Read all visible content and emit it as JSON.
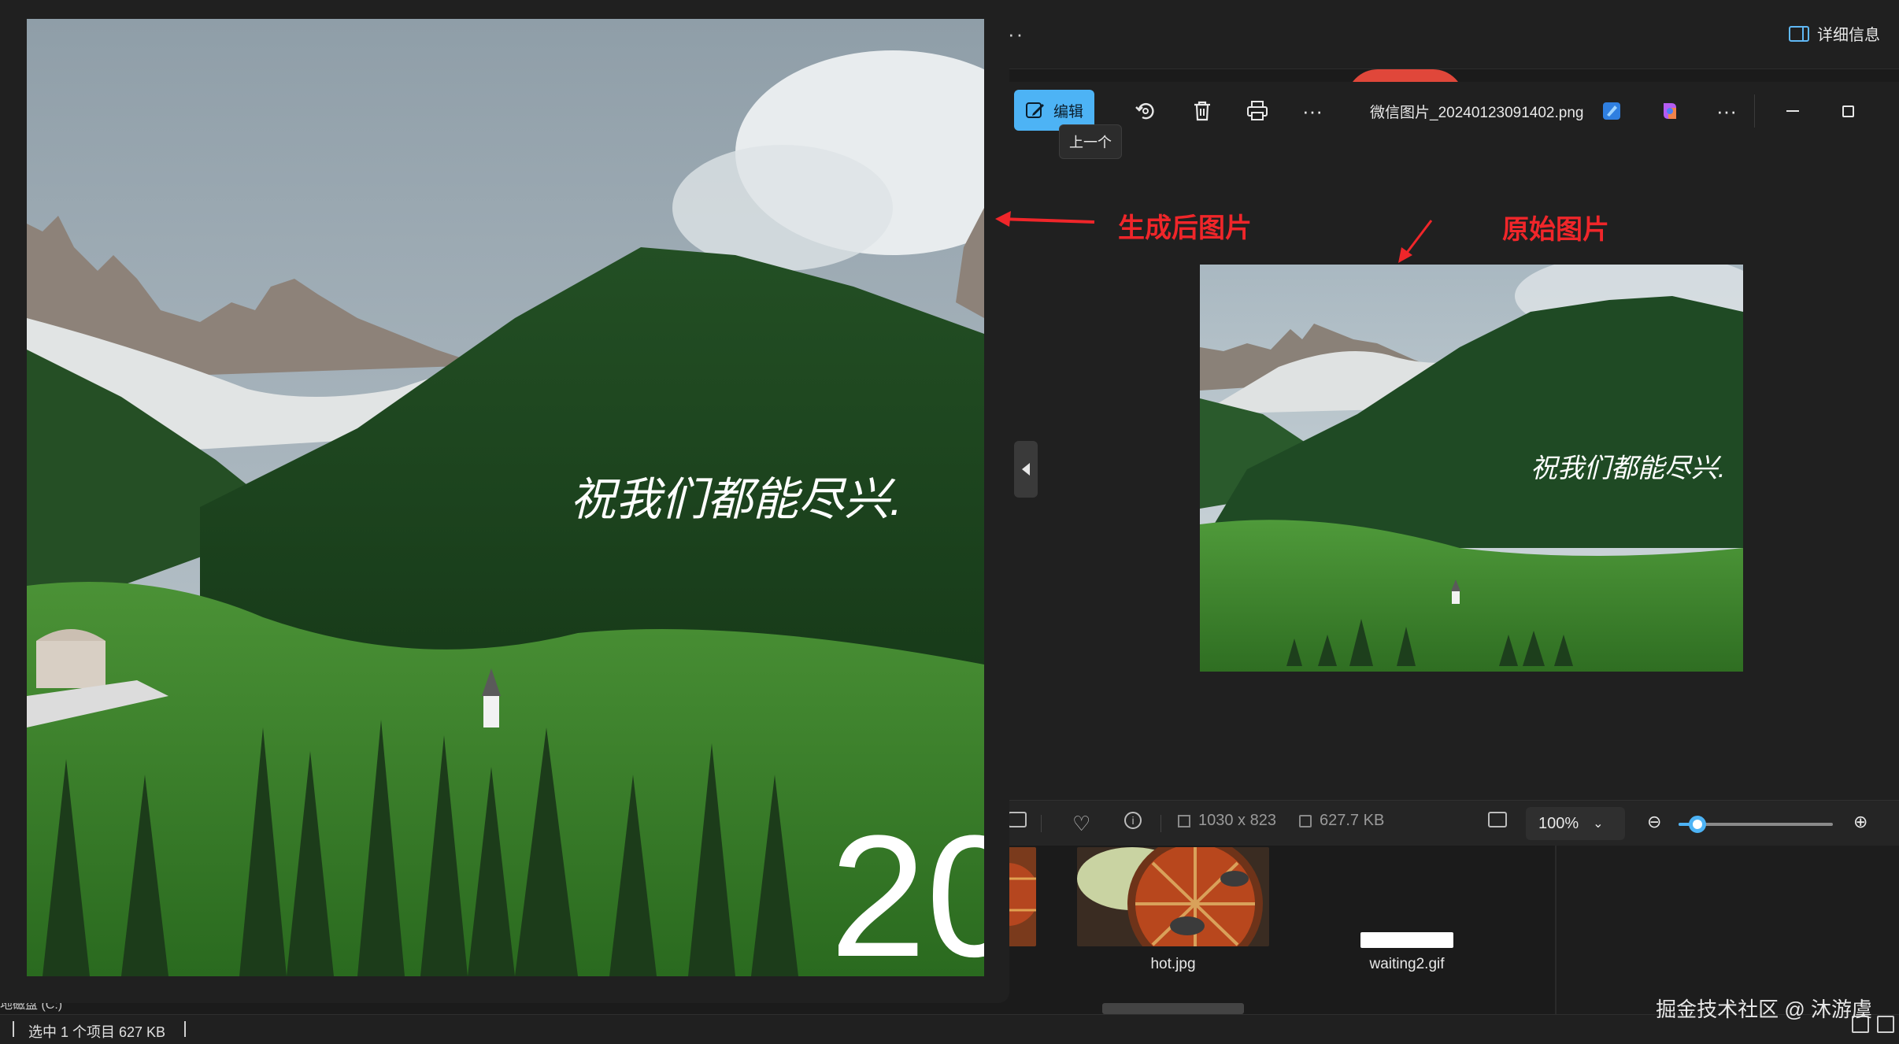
{
  "viewer": {
    "edit_label": "编辑",
    "tooltip": "上一个",
    "filename": "微信图片_20240123091402.png",
    "details_label": "详细信息",
    "dimensions": "1030 x 823",
    "file_size": "627.7 KB",
    "zoom": "100%",
    "zoom_slider_fraction": 0.12
  },
  "filmstrip": {
    "items": [
      {
        "label": "hot.jpg"
      },
      {
        "label": "waiting2.gif"
      }
    ]
  },
  "explorer": {
    "drive": "地磁盘 (C:)",
    "selection": "选中 1 个项目  627 KB"
  },
  "annotations": {
    "generated": "生成后图片",
    "original": "原始图片"
  },
  "image_overlay": {
    "calligraphy": "祝我们都能尽兴.",
    "year_fragment": "20"
  },
  "watermark": "掘金技术社区 @ 沐游虞",
  "colors": {
    "accent": "#4db3f5",
    "annotation": "#f0262a",
    "background": "#202020"
  }
}
